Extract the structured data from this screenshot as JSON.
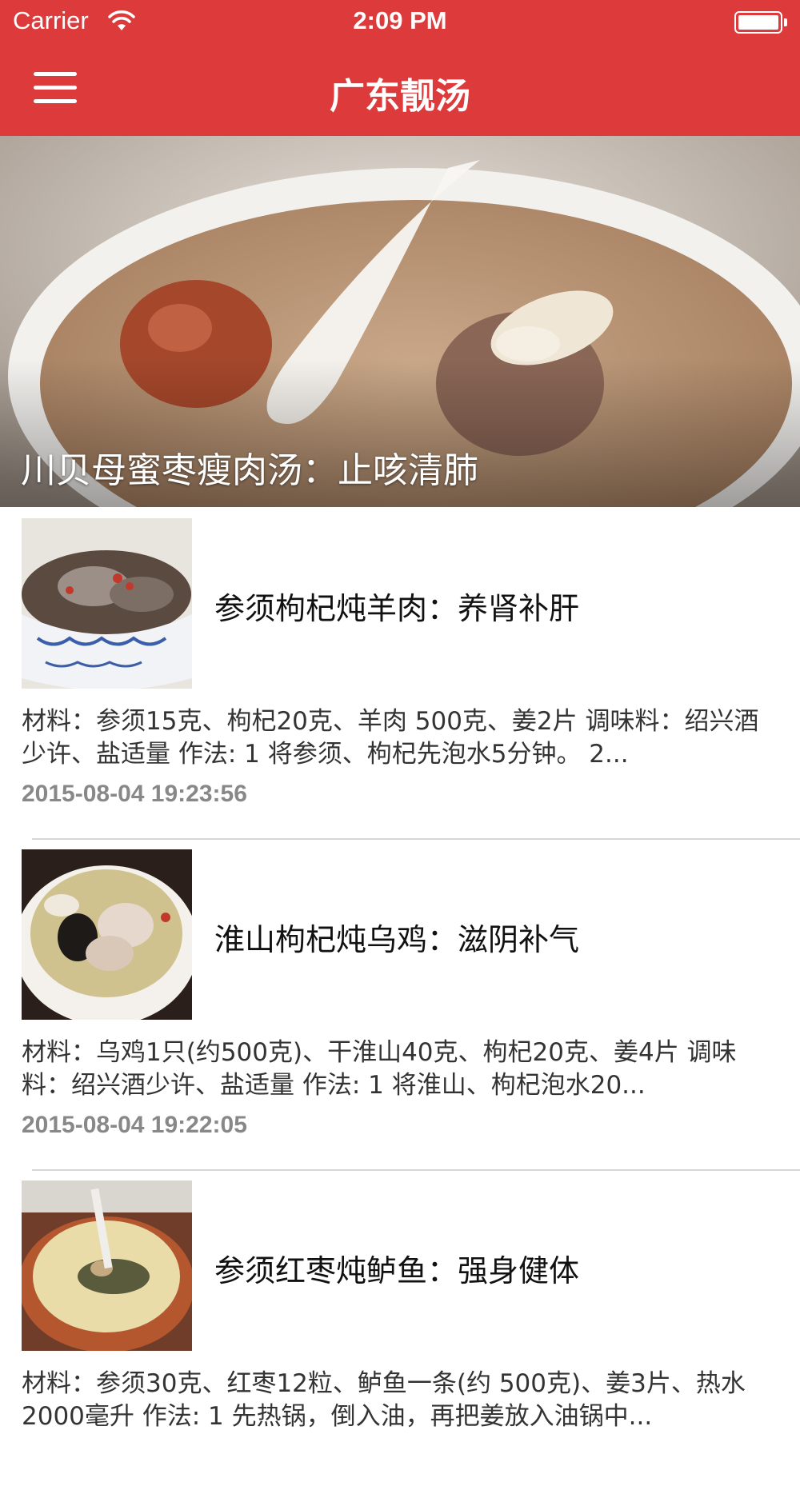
{
  "status_bar": {
    "carrier": "Carrier",
    "time": "2:09 PM"
  },
  "nav": {
    "title": "广东靓汤",
    "menu_icon": "hamburger-icon",
    "background_color": "#dc3a3b"
  },
  "featured": {
    "title": "川贝母蜜枣瘦肉汤：止咳清肺"
  },
  "articles": [
    {
      "title": "参须枸杞炖羊肉：养肾补肝",
      "summary": "材料：参须15克、枸杞20克、羊肉 500克、姜2片 调味料：绍兴酒少许、盐适量 作法: 1 将参须、枸杞先泡水5分钟。 2...",
      "date": "2015-08-04 19:23:56"
    },
    {
      "title": "淮山枸杞炖乌鸡：滋阴补气",
      "summary": "材料：乌鸡1只(约500克)、干淮山40克、枸杞20克、姜4片 调味料：绍兴酒少许、盐适量 作法: 1 将淮山、枸杞泡水20...",
      "date": "2015-08-04 19:22:05"
    },
    {
      "title": "参须红枣炖鲈鱼：强身健体",
      "summary": "材料：参须30克、红枣12粒、鲈鱼一条(约 500克)、姜3片、热水2000毫升 作法: 1 先热锅，倒入油，再把姜放入油锅中...",
      "date": ""
    }
  ]
}
